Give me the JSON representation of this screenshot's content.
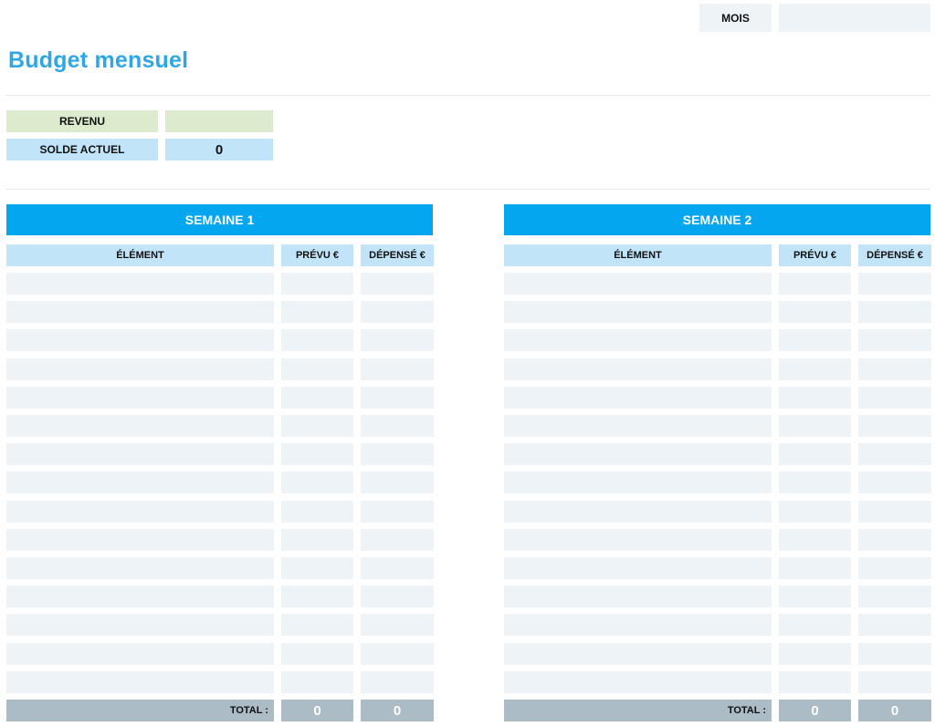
{
  "header": {
    "mois_label": "MOIS",
    "mois_value": "",
    "title": "Budget mensuel"
  },
  "summary": {
    "revenu_label": "REVENU",
    "revenu_value": "",
    "solde_label": "SOLDE ACTUEL",
    "solde_value": "0"
  },
  "weeks": [
    {
      "title": "SEMAINE 1",
      "col_item": "ÉLÉMENT",
      "col_planned": "PRÉVU €",
      "col_spent": "DÉPENSÉ €",
      "total_label": "TOTAL :",
      "total_planned": "0",
      "total_spent": "0",
      "rows": [
        {
          "item": "",
          "planned": "",
          "spent": ""
        },
        {
          "item": "",
          "planned": "",
          "spent": ""
        },
        {
          "item": "",
          "planned": "",
          "spent": ""
        },
        {
          "item": "",
          "planned": "",
          "spent": ""
        },
        {
          "item": "",
          "planned": "",
          "spent": ""
        },
        {
          "item": "",
          "planned": "",
          "spent": ""
        },
        {
          "item": "",
          "planned": "",
          "spent": ""
        },
        {
          "item": "",
          "planned": "",
          "spent": ""
        },
        {
          "item": "",
          "planned": "",
          "spent": ""
        },
        {
          "item": "",
          "planned": "",
          "spent": ""
        },
        {
          "item": "",
          "planned": "",
          "spent": ""
        },
        {
          "item": "",
          "planned": "",
          "spent": ""
        },
        {
          "item": "",
          "planned": "",
          "spent": ""
        },
        {
          "item": "",
          "planned": "",
          "spent": ""
        },
        {
          "item": "",
          "planned": "",
          "spent": ""
        }
      ]
    },
    {
      "title": "SEMAINE 2",
      "col_item": "ÉLÉMENT",
      "col_planned": "PRÉVU €",
      "col_spent": "DÉPENSÉ €",
      "total_label": "TOTAL :",
      "total_planned": "0",
      "total_spent": "0",
      "rows": [
        {
          "item": "",
          "planned": "",
          "spent": ""
        },
        {
          "item": "",
          "planned": "",
          "spent": ""
        },
        {
          "item": "",
          "planned": "",
          "spent": ""
        },
        {
          "item": "",
          "planned": "",
          "spent": ""
        },
        {
          "item": "",
          "planned": "",
          "spent": ""
        },
        {
          "item": "",
          "planned": "",
          "spent": ""
        },
        {
          "item": "",
          "planned": "",
          "spent": ""
        },
        {
          "item": "",
          "planned": "",
          "spent": ""
        },
        {
          "item": "",
          "planned": "",
          "spent": ""
        },
        {
          "item": "",
          "planned": "",
          "spent": ""
        },
        {
          "item": "",
          "planned": "",
          "spent": ""
        },
        {
          "item": "",
          "planned": "",
          "spent": ""
        },
        {
          "item": "",
          "planned": "",
          "spent": ""
        },
        {
          "item": "",
          "planned": "",
          "spent": ""
        },
        {
          "item": "",
          "planned": "",
          "spent": ""
        }
      ]
    }
  ],
  "colors": {
    "title": "#2ea7e8",
    "banner": "#04a7ef",
    "header": "#c1e4f9",
    "revenue": "#dcebce",
    "row": "#eef3f8",
    "total": "#acbcc6"
  }
}
